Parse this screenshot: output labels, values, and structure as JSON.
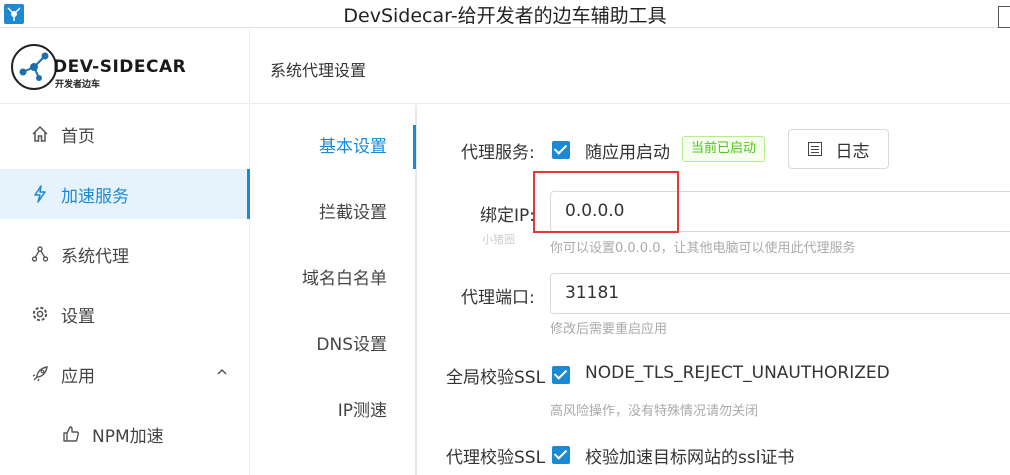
{
  "window": {
    "title": "DevSidecar-给开发者的边车辅助工具"
  },
  "logo": {
    "name": "DEV-SIDECAR",
    "subtitle": "开发者边车"
  },
  "sidebar": {
    "items": [
      {
        "label": "首页",
        "icon": "home-icon"
      },
      {
        "label": "加速服务",
        "icon": "lightning-icon",
        "active": true
      },
      {
        "label": "系统代理",
        "icon": "network-icon"
      },
      {
        "label": "设置",
        "icon": "gear-icon"
      },
      {
        "label": "应用",
        "icon": "rocket-icon",
        "expanded": true
      },
      {
        "label": "NPM加速",
        "icon": "thumbs-up-icon"
      }
    ]
  },
  "content": {
    "title": "系统代理设置"
  },
  "tabs": [
    {
      "label": "基本设置",
      "active": true
    },
    {
      "label": "拦截设置"
    },
    {
      "label": "域名白名单"
    },
    {
      "label": "DNS设置"
    },
    {
      "label": "IP测速"
    }
  ],
  "form": {
    "proxy_service": {
      "label": "代理服务:",
      "checkbox_label": "随应用启动",
      "checked": true,
      "status_tag": "当前已启动",
      "log_button": "日志"
    },
    "bind_ip": {
      "label": "绑定IP:",
      "value": "0.0.0.0",
      "hint": "你可以设置0.0.0.0，让其他电脑可以使用此代理服务"
    },
    "proxy_port": {
      "label": "代理端口:",
      "value": "31181",
      "hint": "修改后需要重启应用"
    },
    "global_ssl": {
      "label": "全局校验SSL",
      "checkbox_label": "NODE_TLS_REJECT_UNAUTHORIZED",
      "checked": true,
      "hint": "高风险操作，没有特殊情况请勿关闭"
    },
    "proxy_ssl": {
      "label": "代理校验SSL",
      "checkbox_label": "校验加速目标网站的ssl证书",
      "checked": true
    }
  },
  "watermark": "小猪圈",
  "colors": {
    "accent": "#1a8ad6",
    "success": "#52c41a",
    "highlight": "#e53935"
  }
}
